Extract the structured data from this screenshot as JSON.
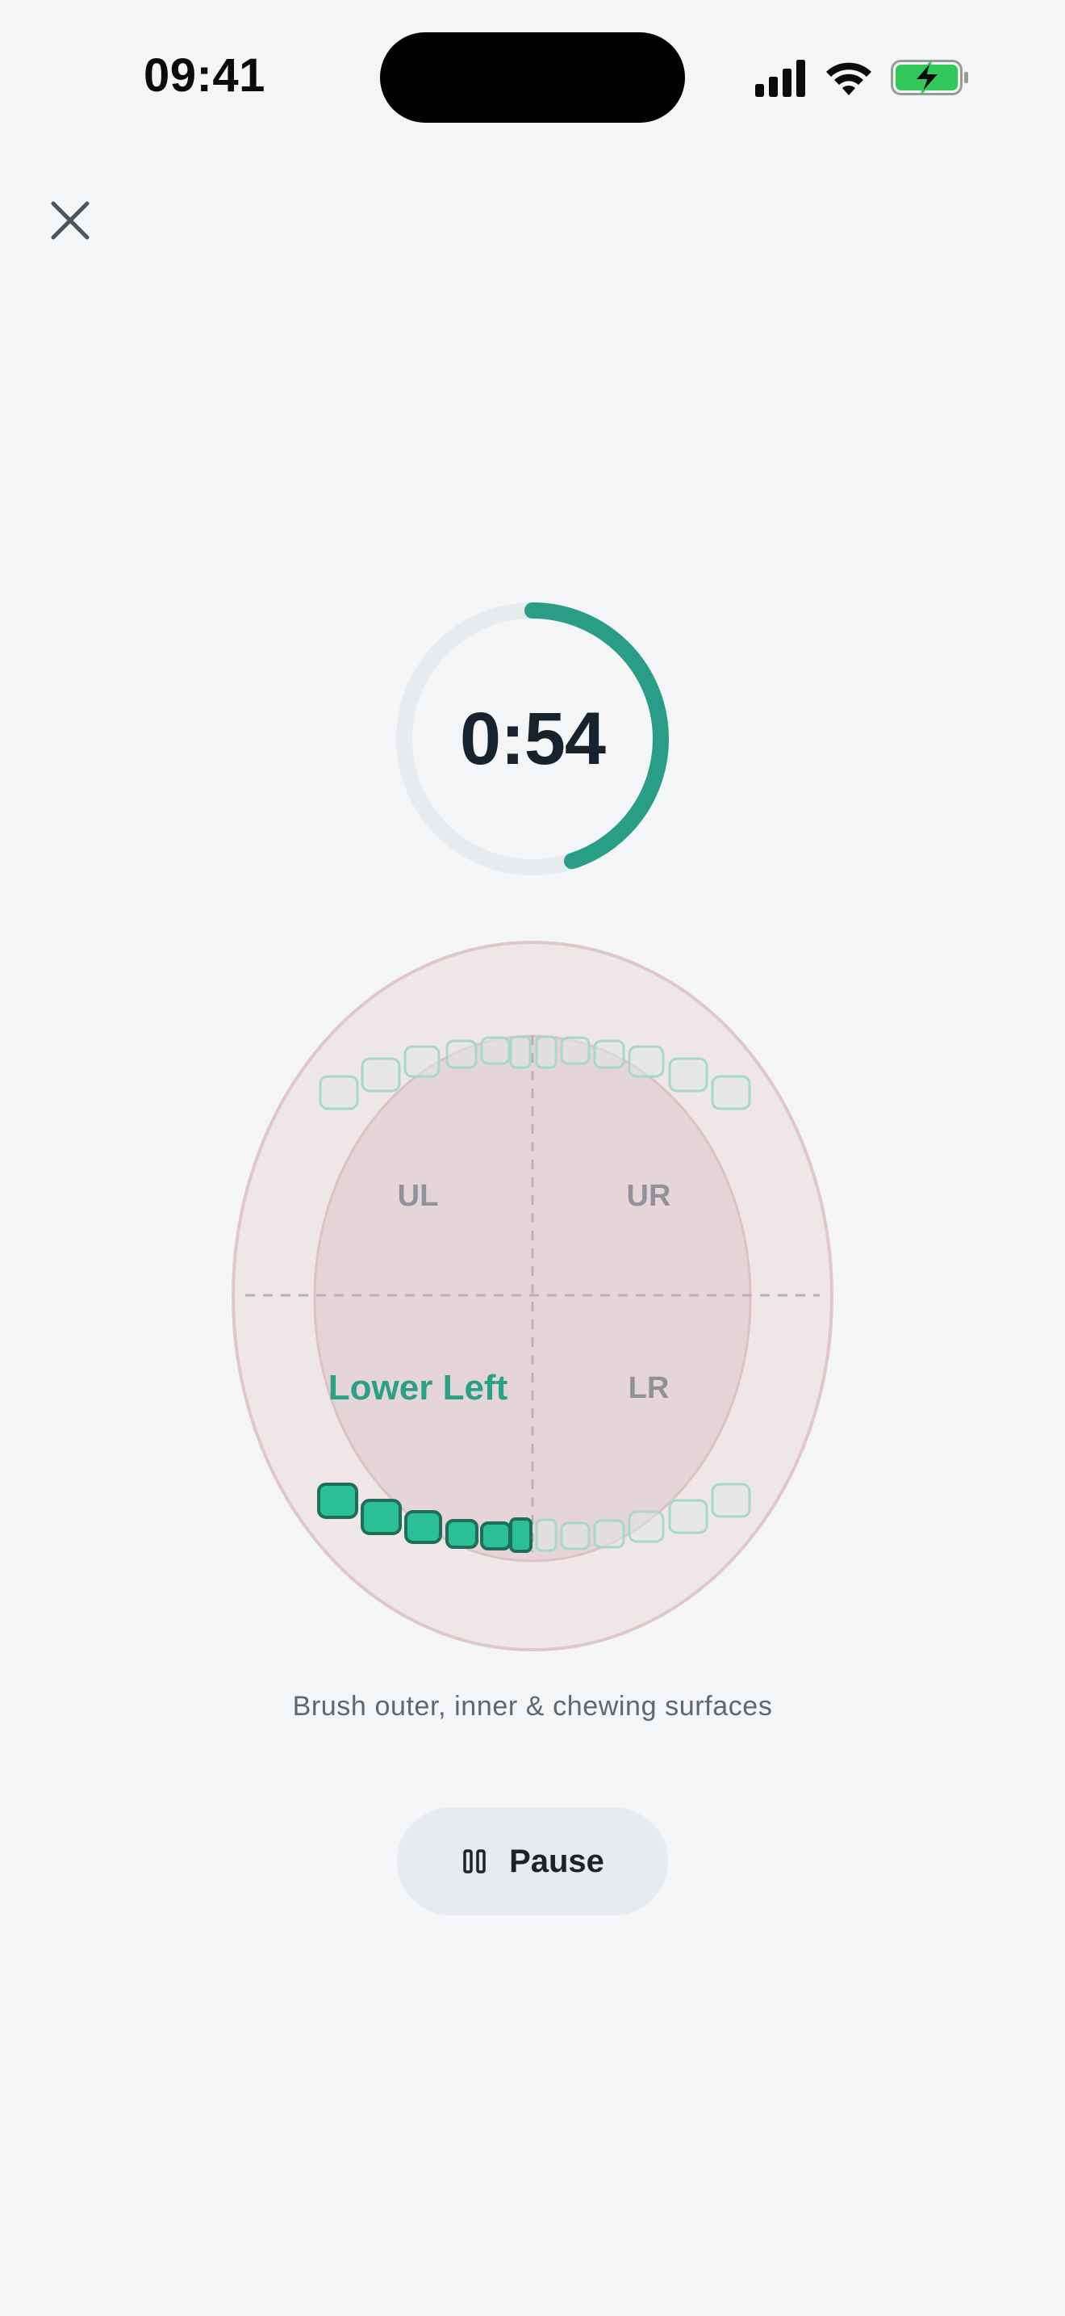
{
  "status_bar": {
    "time": "09:41",
    "icons": [
      "cellular-signal-icon",
      "wifi-icon",
      "battery-charging-icon"
    ],
    "battery_color": "#34c759"
  },
  "header": {
    "close_icon": "close-icon"
  },
  "timer": {
    "time_remaining": "0:54",
    "progress_fraction": 0.45,
    "accent_color": "#2a9d87",
    "track_color": "#e8ebee"
  },
  "mouth_map": {
    "quadrants": {
      "upper_left": "UL",
      "upper_right": "UR",
      "lower_left": "Lower Left",
      "lower_right": "LR"
    },
    "active_quadrant": "lower_left",
    "active_color": "#2bbf98",
    "inactive_tooth_color": "#9fd8c8"
  },
  "instructions": {
    "text": "Brush outer, inner & chewing surfaces"
  },
  "controls": {
    "pause_label": "Pause",
    "pause_icon": "pause-icon"
  }
}
